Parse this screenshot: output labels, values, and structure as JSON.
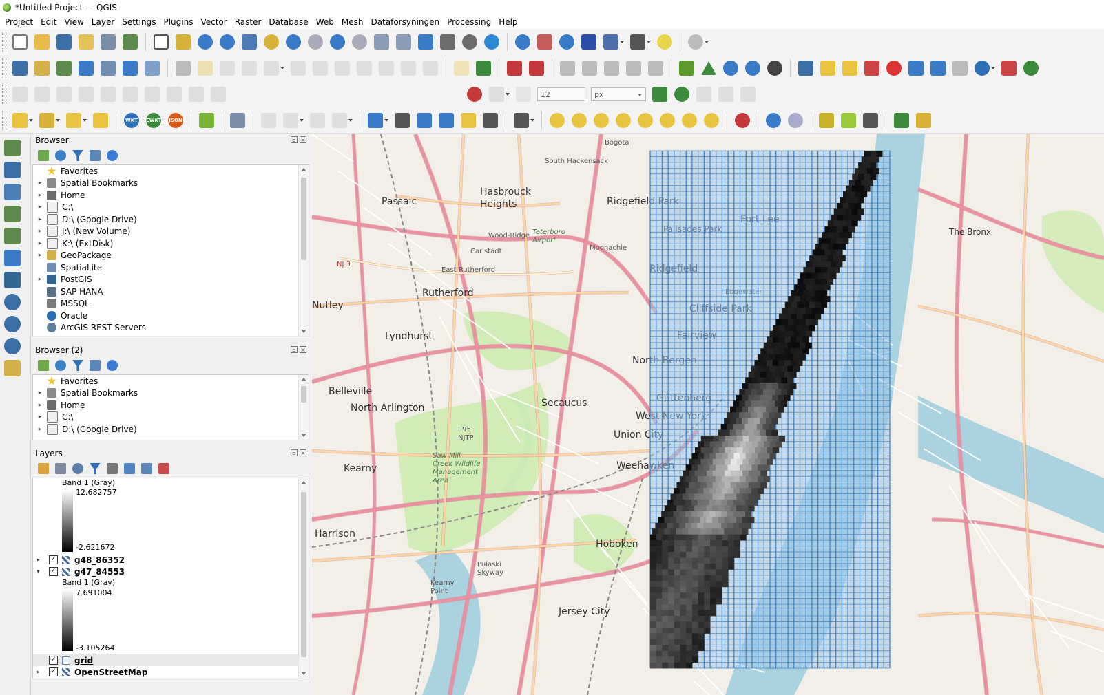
{
  "window": {
    "title": "*Untitled Project — QGIS"
  },
  "menu": [
    "Project",
    "Edit",
    "View",
    "Layer",
    "Settings",
    "Plugins",
    "Vector",
    "Raster",
    "Database",
    "Web",
    "Mesh",
    "Dataforsyningen",
    "Processing",
    "Help"
  ],
  "toolbar": {
    "snap_tolerance": "12",
    "snap_units": "px",
    "icons_row1": [
      "new-project-icon",
      "open-project-icon",
      "save-project-icon",
      "save-as-icon",
      "print-layout-icon",
      "layout-manager-icon",
      "pan-icon",
      "pan-to-selection-icon",
      "zoom-in-icon",
      "zoom-out-icon",
      "zoom-full-icon",
      "zoom-to-selection-icon",
      "zoom-to-layer-icon",
      "zoom-native-icon",
      "zoom-last-icon",
      "zoom-next-icon",
      "new-map-view-icon",
      "new-3d-view-icon",
      "new-bookmark-icon",
      "show-bookmarks-icon",
      "temporal-controller-icon",
      "refresh-icon",
      "identify-icon",
      "attribute-table-icon",
      "toolbox-icon",
      "statistics-icon",
      "open-field-calc-icon",
      "measure-icon",
      "annotation-icon",
      "select-icon"
    ],
    "format_buttons": [
      "WKT",
      "EWKT",
      "JSON"
    ]
  },
  "browser": {
    "title": "Browser",
    "items": [
      {
        "label": "Favorites",
        "icon": "star-icon",
        "expandable": false
      },
      {
        "label": "Spatial Bookmarks",
        "icon": "bookmark-icon",
        "expandable": true
      },
      {
        "label": "Home",
        "icon": "home-folder-icon",
        "expandable": true
      },
      {
        "label": "C:\\",
        "icon": "folder-icon",
        "expandable": true
      },
      {
        "label": "D:\\ (Google Drive)",
        "icon": "folder-icon",
        "expandable": true
      },
      {
        "label": "J:\\ (New Volume)",
        "icon": "folder-icon",
        "expandable": true
      },
      {
        "label": "K:\\ (ExtDisk)",
        "icon": "folder-icon",
        "expandable": true
      },
      {
        "label": "GeoPackage",
        "icon": "geopackage-icon",
        "expandable": true
      },
      {
        "label": "SpatiaLite",
        "icon": "spatialite-icon",
        "expandable": false
      },
      {
        "label": "PostGIS",
        "icon": "postgis-icon",
        "expandable": true
      },
      {
        "label": "SAP HANA",
        "icon": "sap-hana-icon",
        "expandable": false
      },
      {
        "label": "MSSQL",
        "icon": "mssql-icon",
        "expandable": false
      },
      {
        "label": "Oracle",
        "icon": "oracle-icon",
        "expandable": false
      },
      {
        "label": "ArcGIS REST Servers",
        "icon": "arcgis-icon",
        "expandable": false
      }
    ]
  },
  "browser2": {
    "title": "Browser (2)",
    "items": [
      {
        "label": "Favorites",
        "icon": "star-icon",
        "expandable": false
      },
      {
        "label": "Spatial Bookmarks",
        "icon": "bookmark-icon",
        "expandable": true
      },
      {
        "label": "Home",
        "icon": "home-folder-icon",
        "expandable": true
      },
      {
        "label": "C:\\",
        "icon": "folder-icon",
        "expandable": true
      },
      {
        "label": "D:\\ (Google Drive)",
        "icon": "folder-icon",
        "expandable": true
      }
    ]
  },
  "layers": {
    "title": "Layers",
    "top_legend": {
      "band": "Band 1 (Gray)",
      "max": "12.682757",
      "min": "-2.621672"
    },
    "items": [
      {
        "name": "g48_86352",
        "checked": true,
        "expanded": false
      },
      {
        "name": "g47_84553",
        "checked": true,
        "expanded": true,
        "band": "Band 1 (Gray)",
        "max": "7.691004",
        "min": "-3.105264"
      },
      {
        "name": "grid",
        "checked": true,
        "expanded": false
      },
      {
        "name": "OpenStreetMap",
        "checked": true,
        "expanded": false
      }
    ]
  },
  "map": {
    "places": [
      "Bogota",
      "South Hackensack",
      "Hasbrouck Heights",
      "Passaic",
      "Ridgefield Park",
      "Fort Lee",
      "Palisades Park",
      "The Bronx",
      "Wood-Ridge",
      "Carlstadt",
      "Teterboro Airport",
      "Moonachie",
      "East Rutherford",
      "Ridgefield",
      "Rutherford",
      "Nutley",
      "Edgewater",
      "Cliffside Park",
      "Lyndhurst",
      "Fairview",
      "North Bergen",
      "Belleville",
      "North Arlington",
      "Secaucus",
      "Guttenberg",
      "West New York",
      "Union City",
      "Kearny",
      "Weehawken",
      "Harrison",
      "Hoboken",
      "Pulaski Skyway",
      "Jersey City",
      "Kearny Point",
      "Sawmill Creek Wildlife Management Area",
      "I 95 NJTP",
      "NJ 3"
    ],
    "colors": {
      "base": "#f2efe9",
      "park": "#cdebb0",
      "water": "#aad3df",
      "road_major": "#e892a2",
      "road_primary": "#fcd6a4",
      "grid": "#3a7fc0"
    }
  }
}
